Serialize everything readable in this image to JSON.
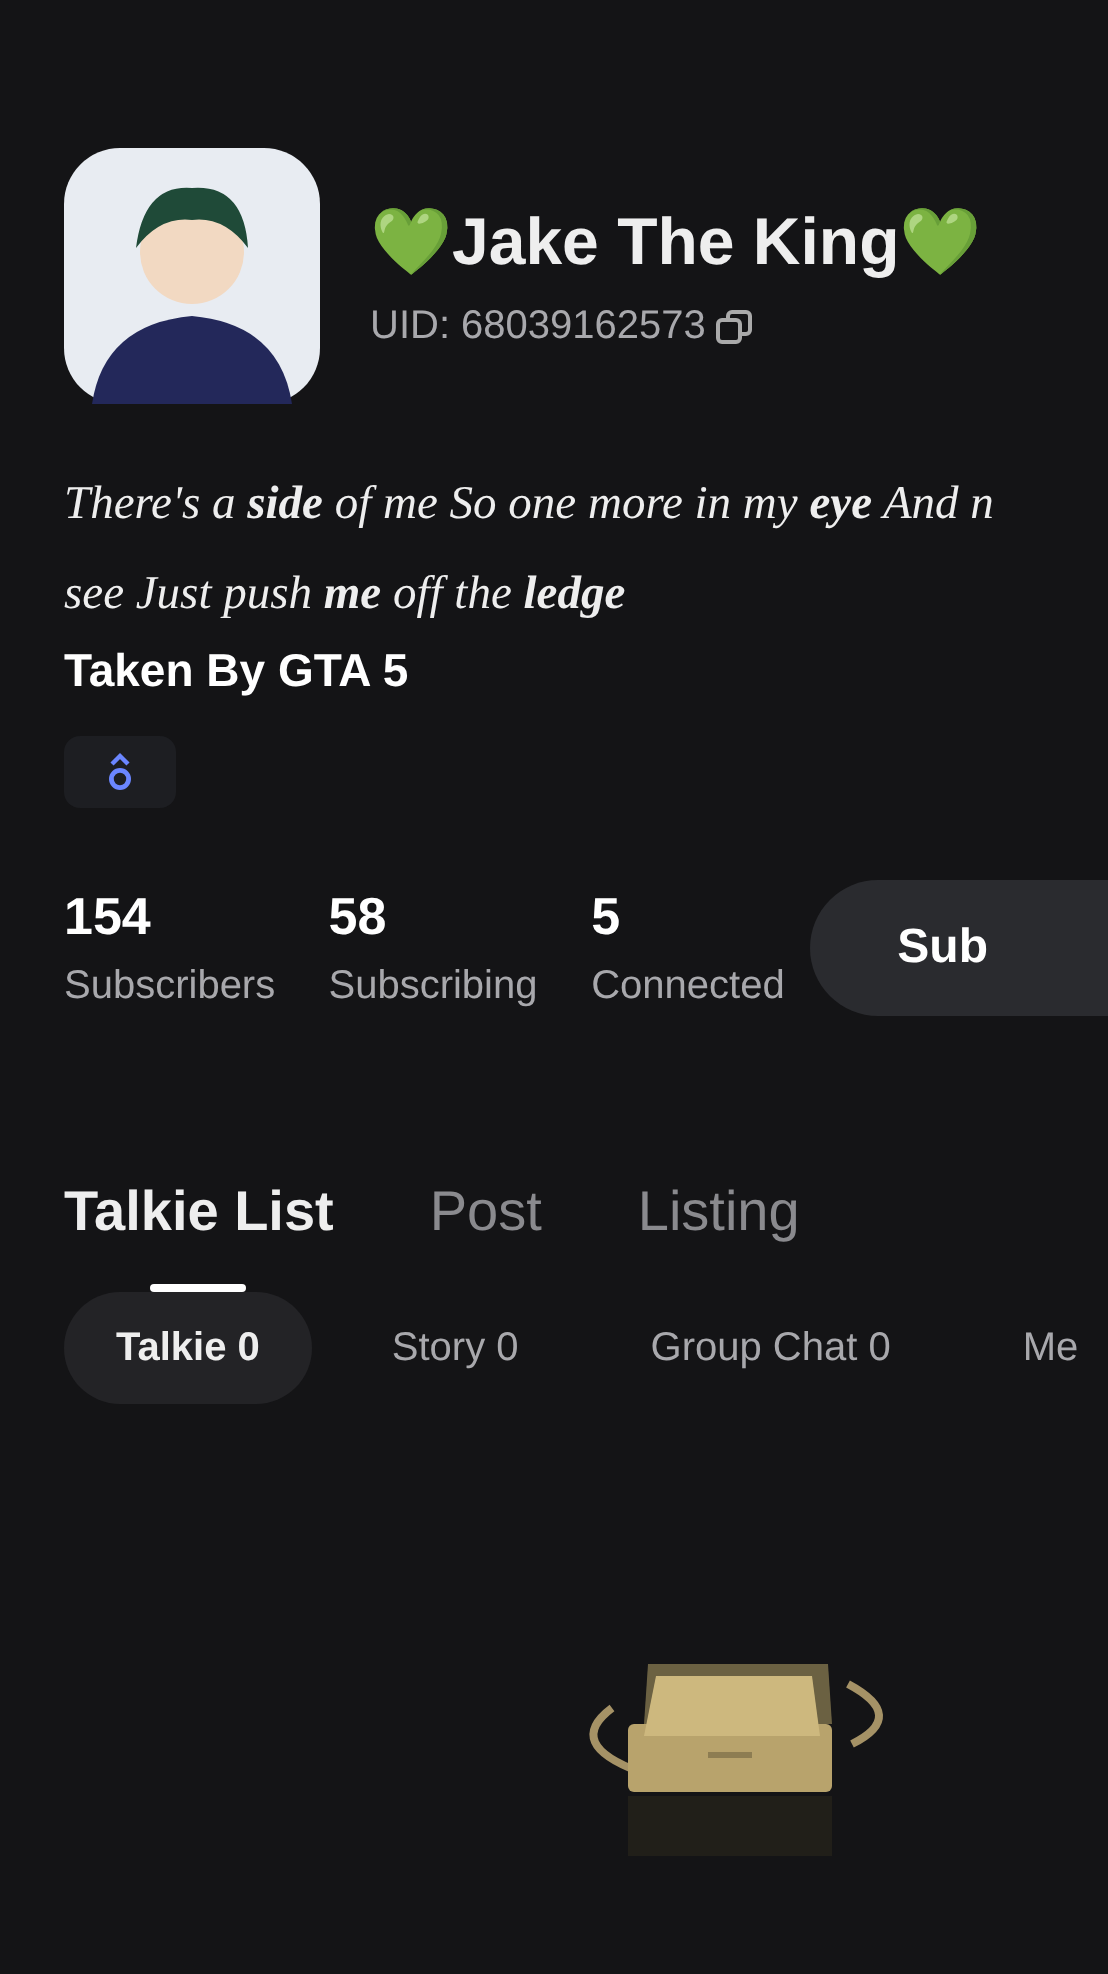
{
  "profile": {
    "name": "💚Jake The King💚",
    "uid": "UID: 68039162573",
    "bio_lines": [
      "There's a **side** of me So one more in my **eye** And n",
      "see Just push **me** off the **ledge**"
    ],
    "tagline": "Taken By GTA 5"
  },
  "stats": [
    {
      "value": "154",
      "label": "Subscribers"
    },
    {
      "value": "58",
      "label": "Subscribing"
    },
    {
      "value": "5",
      "label": "Connected"
    }
  ],
  "subscribe_button": "Sub",
  "tabs": [
    {
      "label": "Talkie List",
      "selected": true
    },
    {
      "label": "Post",
      "selected": false
    },
    {
      "label": "Listing",
      "selected": false
    }
  ],
  "filters": [
    {
      "label": "Talkie 0",
      "selected": true
    },
    {
      "label": "Story 0",
      "selected": false
    },
    {
      "label": "Group Chat 0",
      "selected": false
    },
    {
      "label": "Me",
      "selected": false
    }
  ]
}
